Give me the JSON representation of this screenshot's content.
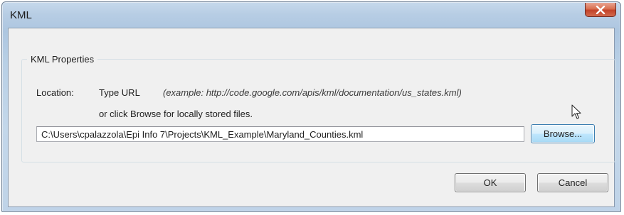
{
  "window": {
    "title": "KML",
    "close_symbol": "x",
    "close_icon": "close-icon",
    "close_color": "#c2422a"
  },
  "group": {
    "legend": "KML Properties",
    "location_label": "Location:",
    "type_url_label": "Type URL",
    "example_text": "(example: http://code.google.com/apis/kml/documentation/us_states.kml)",
    "browse_hint": "or click Browse for locally stored files.",
    "path_value": "C:\\Users\\cpalazzola\\Epi Info 7\\Projects\\KML_Example\\Maryland_Counties.kml",
    "browse_label": "Browse..."
  },
  "buttons": {
    "ok_label": "OK",
    "cancel_label": "Cancel"
  },
  "pointer": {
    "icon": "mouse-pointer-icon"
  }
}
